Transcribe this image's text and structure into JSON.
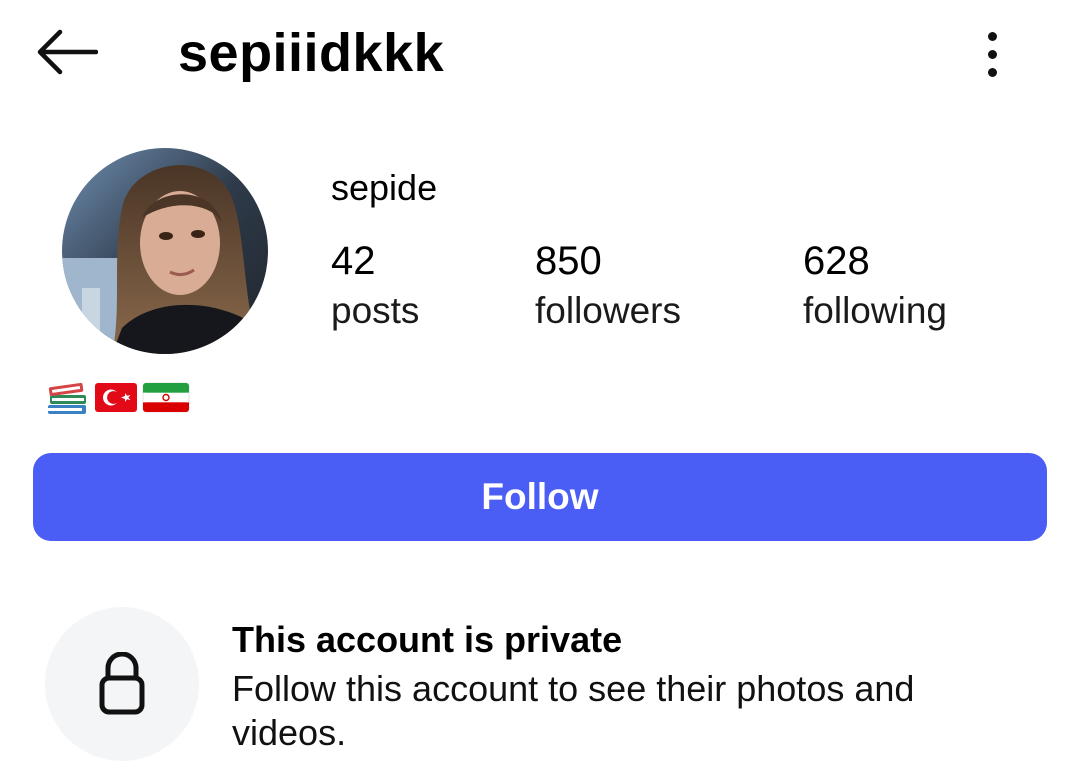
{
  "header": {
    "username": "sepiiidkkk",
    "back_icon": "arrow-left-icon",
    "more_icon": "more-vertical-icon"
  },
  "profile": {
    "display_name": "sepide",
    "avatar_icon": "profile-photo",
    "stats": [
      {
        "count": "42",
        "label": "posts"
      },
      {
        "count": "850",
        "label": "followers"
      },
      {
        "count": "628",
        "label": "following"
      }
    ],
    "bio_icons": [
      "books-emoji",
      "turkey-flag-emoji",
      "iran-flag-emoji"
    ]
  },
  "actions": {
    "follow_label": "Follow",
    "follow_color": "#4a5df4"
  },
  "private_notice": {
    "title": "This account is private",
    "description": "Follow this account to see their photos and videos.",
    "icon": "lock-icon"
  }
}
